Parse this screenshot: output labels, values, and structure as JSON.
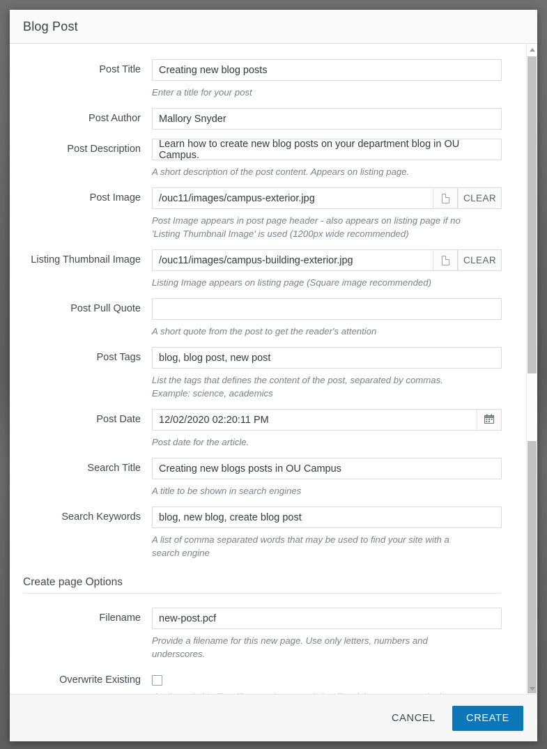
{
  "dialog": {
    "title": "Blog Post"
  },
  "fields": [
    {
      "label": "Post Title",
      "value": "Creating new blog posts",
      "hint": "Enter a title for your post",
      "type": "text"
    },
    {
      "label": "Post Author",
      "value": "Mallory Snyder",
      "hint": "",
      "type": "text"
    },
    {
      "label": "Post Description",
      "value": "Learn how to create new blog posts on your department blog in OU Campus.",
      "hint": "A short description of the post content. Appears on listing page.",
      "type": "text"
    },
    {
      "label": "Post Image",
      "value": "/ouc11/images/campus-exterior.jpg",
      "hint": "Post Image appears in post page header - also appears on listing page if no 'Listing Thumbnail Image' is used (1200px wide recommended)",
      "type": "file",
      "browse_icon": "file-icon",
      "clear_label": "CLEAR"
    },
    {
      "label": "Listing Thumbnail Image",
      "value": "/ouc11/images/campus-building-exterior.jpg",
      "hint": "Listing Image appears on listing page (Square image recommended)",
      "type": "file",
      "browse_icon": "file-icon",
      "clear_label": "CLEAR"
    },
    {
      "label": "Post Pull Quote",
      "value": "",
      "hint": "A short quote from the post to get the reader's attention",
      "type": "text"
    },
    {
      "label": "Post Tags",
      "value": "blog, blog post, new post",
      "hint": "List the tags that defines the content of the post, separated by commas. Example: science, academics",
      "type": "text"
    },
    {
      "label": "Post Date",
      "value": "12/02/2020 02:20:11 PM",
      "hint": "Post date for the article.",
      "type": "date",
      "calendar_icon": "calendar-icon"
    },
    {
      "label": "Search Title",
      "value": "Creating new blogs posts in OU Campus",
      "hint": "A title to be shown in search engines",
      "type": "text"
    },
    {
      "label": "Search Keywords",
      "value": "blog, new blog, create blog post",
      "hint": "A list of comma separated words that may be used to find your site with a search engine",
      "type": "text"
    }
  ],
  "section": {
    "title": "Create page Options"
  },
  "options": [
    {
      "label": "Filename",
      "value": "new-post.pcf",
      "hint": "Provide a filename for this new page. Use only letters, numbers and underscores.",
      "type": "text"
    },
    {
      "label": "Overwrite Existing",
      "checked": false,
      "hint": "If selected, this file will overwrite any existing file of the same name in the same location.",
      "type": "checkbox"
    }
  ],
  "footer": {
    "cancel_label": "CANCEL",
    "create_label": "CREATE",
    "create_color": "#0b76b8"
  },
  "scrollbar": {
    "up_icon": "chevron-up-icon",
    "down_icon": "chevron-down-icon"
  }
}
